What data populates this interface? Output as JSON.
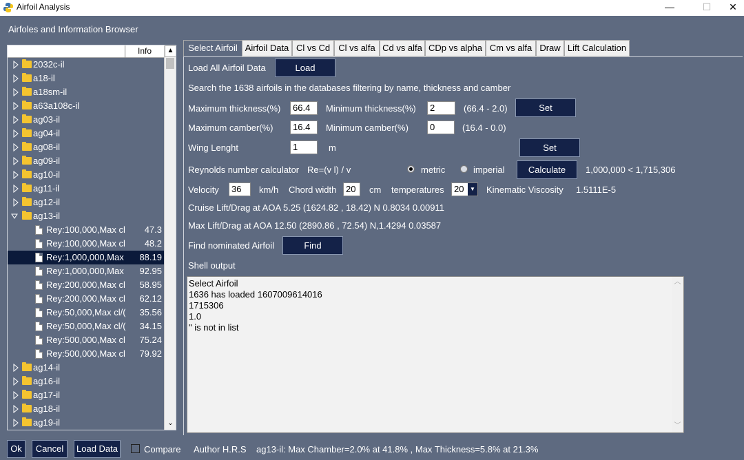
{
  "window": {
    "title": "Airfoil Analysis",
    "min": "—",
    "max": "☐",
    "close": "✕"
  },
  "header": {
    "label": "Airfoles and Information Browser"
  },
  "tree": {
    "columns": [
      "",
      "Info"
    ],
    "rows": [
      {
        "label": "2032c-il",
        "val": "",
        "kind": "folder",
        "exp": false
      },
      {
        "label": "a18-il",
        "val": "",
        "kind": "folder",
        "exp": false
      },
      {
        "label": "a18sm-il",
        "val": "",
        "kind": "folder",
        "exp": false
      },
      {
        "label": "a63a108c-il",
        "val": "",
        "kind": "folder",
        "exp": false
      },
      {
        "label": "ag03-il",
        "val": "",
        "kind": "folder",
        "exp": false
      },
      {
        "label": "ag04-il",
        "val": "",
        "kind": "folder",
        "exp": false
      },
      {
        "label": "ag08-il",
        "val": "",
        "kind": "folder",
        "exp": false
      },
      {
        "label": "ag09-il",
        "val": "",
        "kind": "folder",
        "exp": false
      },
      {
        "label": "ag10-il",
        "val": "",
        "kind": "folder",
        "exp": false
      },
      {
        "label": "ag11-il",
        "val": "",
        "kind": "folder",
        "exp": false
      },
      {
        "label": "ag12-il",
        "val": "",
        "kind": "folder",
        "exp": false
      },
      {
        "label": "ag13-il",
        "val": "",
        "kind": "folder",
        "exp": true
      },
      {
        "label": "Rey:100,000,Max cl",
        "val": "47.3",
        "kind": "doc"
      },
      {
        "label": "Rey:100,000,Max cl",
        "val": "48.2",
        "kind": "doc"
      },
      {
        "label": "Rey:1,000,000,Max",
        "val": "88.19",
        "kind": "doc",
        "selected": true
      },
      {
        "label": "Rey:1,000,000,Max",
        "val": "92.95",
        "kind": "doc"
      },
      {
        "label": "Rey:200,000,Max cl",
        "val": "58.95",
        "kind": "doc"
      },
      {
        "label": "Rey:200,000,Max cl",
        "val": "62.12",
        "kind": "doc"
      },
      {
        "label": "Rey:50,000,Max cl/(",
        "val": "35.56",
        "kind": "doc"
      },
      {
        "label": "Rey:50,000,Max cl/(",
        "val": "34.15",
        "kind": "doc"
      },
      {
        "label": "Rey:500,000,Max cl",
        "val": "75.24",
        "kind": "doc"
      },
      {
        "label": "Rey:500,000,Max cl",
        "val": "79.92",
        "kind": "doc"
      },
      {
        "label": "ag14-il",
        "val": "",
        "kind": "folder",
        "exp": false
      },
      {
        "label": "ag16-il",
        "val": "",
        "kind": "folder",
        "exp": false
      },
      {
        "label": "ag17-il",
        "val": "",
        "kind": "folder",
        "exp": false
      },
      {
        "label": "ag18-il",
        "val": "",
        "kind": "folder",
        "exp": false
      },
      {
        "label": "ag19-il",
        "val": "",
        "kind": "folder",
        "exp": false
      }
    ]
  },
  "tabs": [
    "Select Airfoil",
    "Airfoil Data",
    "Cl vs Cd",
    "Cl vs alfa",
    "Cd vs alfa",
    "CDp vs alpha",
    "Cm vs alfa",
    "Draw",
    "Lift Calculation"
  ],
  "form": {
    "load_label": "Load All Airfoil Data",
    "load_btn": "Load",
    "search_text": "Search the 1638 airfoils in the databases filtering by name, thickness and camber",
    "max_thick_label": "Maximum thickness(%)",
    "max_thick_val": "66.4",
    "min_thick_label": "Minimum  thickness(%)",
    "min_thick_val": "2",
    "thick_range": "(66.4 - 2.0)",
    "set_btn": "Set",
    "max_camber_label": "Maximum     camber(%)",
    "max_camber_val": "16.4",
    "min_camber_label": "Minimum      camber(%)",
    "min_camber_val": "0",
    "camber_range": "(16.4 - 0.0)",
    "wing_label": "Wing Lenght",
    "wing_val": "1",
    "wing_unit": "m",
    "set_btn2": "Set",
    "reynolds_label": "Reynolds number calculator",
    "reynolds_formula": "Re=(v l) / v",
    "metric": "metric",
    "imperial": "imperial",
    "calc_btn": "Calculate",
    "reynolds_result": "1,000,000 < 1,715,306",
    "velocity_label": "Velocity",
    "velocity_val": "36",
    "velocity_unit": "km/h",
    "chord_label": "Chord width",
    "chord_val": "20",
    "chord_unit": "cm",
    "temp_label": "temperatures",
    "temp_val": "20",
    "kv_label": "Kinematic Viscosity",
    "kv_val": "1.5111E-5",
    "cruise": "Cruise Lift/Drag at AOA  5.25 (1624.82 , 18.42) N 0.8034 0.00911",
    "max": "Max    Lift/Drag at AOA 12.50 (2890.86 , 72.54) N,1.4294 0.03587",
    "find_label": "Find nominated Airfoil",
    "find_btn": "Find",
    "shell_label": "Shell output",
    "shell_lines": [
      "Select Airfoil",
      "1636 has loaded  1607009614016",
      "1715306",
      "1.0",
      "\" is not in list"
    ]
  },
  "footer": {
    "ok": "Ok",
    "cancel": "Cancel",
    "load_data": "Load Data",
    "compare": "Compare",
    "author": "Author H.R.S",
    "status": "ag13-il: Max Chamber=2.0% at 41.8% , Max Thickness=5.8% at 21.3%"
  }
}
